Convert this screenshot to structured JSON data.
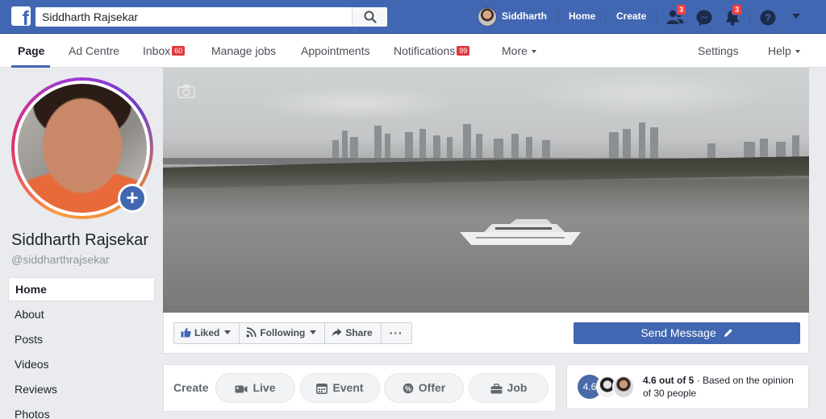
{
  "topbar": {
    "logo": "f",
    "search_value": "Siddharth Rajsekar",
    "search_placeholder": "Search",
    "user_name": "Siddharth",
    "home_label": "Home",
    "create_label": "Create",
    "friend_requests_badge": "3",
    "notifications_badge": "3",
    "icons": [
      "facebook-logo",
      "search-icon",
      "friend-requests-icon",
      "messenger-icon",
      "notifications-icon",
      "help-icon",
      "account-menu-caret"
    ]
  },
  "pagenav": {
    "tabs": [
      {
        "label": "Page",
        "active": true
      },
      {
        "label": "Ad Centre"
      },
      {
        "label": "Inbox",
        "badge": "60"
      },
      {
        "label": "Manage jobs"
      },
      {
        "label": "Appointments"
      },
      {
        "label": "Notifications",
        "badge": "99"
      },
      {
        "label": "More"
      }
    ],
    "settings_label": "Settings",
    "help_label": "Help"
  },
  "profile": {
    "name": "Siddharth Rajsekar",
    "handle": "@siddharthrajsekar"
  },
  "sidebar": {
    "items": [
      {
        "label": "Home",
        "active": true
      },
      {
        "label": "About"
      },
      {
        "label": "Posts"
      },
      {
        "label": "Videos"
      },
      {
        "label": "Reviews"
      },
      {
        "label": "Photos"
      }
    ]
  },
  "actions": {
    "liked_label": "Liked",
    "following_label": "Following",
    "share_label": "Share",
    "more_label": "···",
    "send_message_label": "Send Message"
  },
  "create": {
    "label": "Create",
    "buttons": [
      "Live",
      "Event",
      "Offer",
      "Job"
    ]
  },
  "rating": {
    "score": "4.6",
    "score_text": "4.6 out of 5",
    "based_on_text": " · Based on the opinion of 30 people"
  },
  "colors": {
    "brand_blue": "#4267b2",
    "badge_red": "#fa3e3e",
    "background": "#e9ebee"
  }
}
